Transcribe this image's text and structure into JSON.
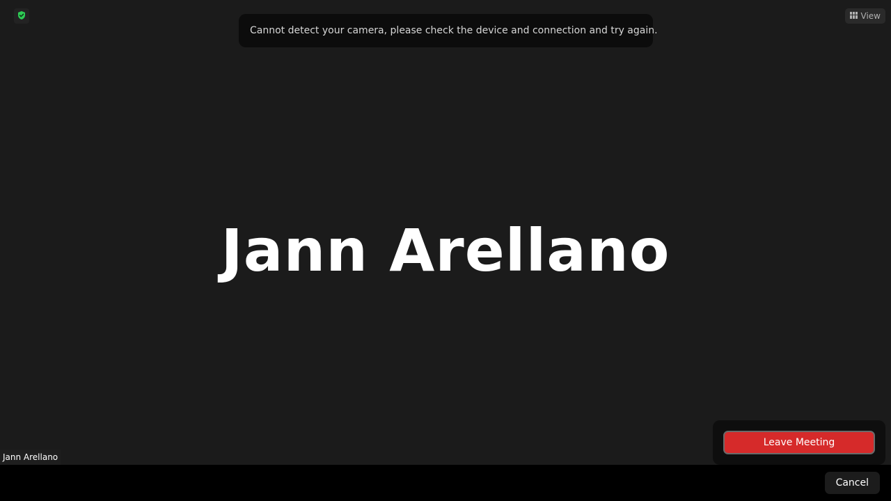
{
  "toast": {
    "message": "Cannot detect your camera, please check the device and connection and try again."
  },
  "header": {
    "security_icon": "shield-check-icon",
    "security_color": "#2ecc55",
    "view_icon": "grid-icon",
    "view_label": "View"
  },
  "video": {
    "participant_display_name": "Jann Arellano",
    "name_tag": "Jann Arellano"
  },
  "leave_panel": {
    "leave_label": "Leave Meeting",
    "leave_color": "#d62a2a"
  },
  "footer": {
    "cancel_label": "Cancel"
  }
}
